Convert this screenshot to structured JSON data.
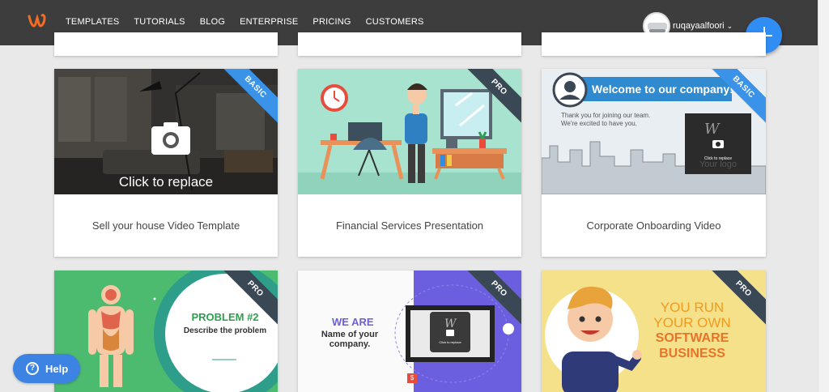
{
  "nav": {
    "logo_icon": "wideo-w-logo",
    "items": [
      "TEMPLATES",
      "TUTORIALS",
      "BLOG",
      "ENTERPRISE",
      "PRICING",
      "CUSTOMERS"
    ]
  },
  "user": {
    "name": "ruqayaalfoori",
    "caret": "⌄"
  },
  "fab": {
    "icon": "plus-icon"
  },
  "colors": {
    "topbar": "#3d3d3d",
    "accent": "#2f8df4",
    "basic_ribbon": "#3a93e8",
    "pro_ribbon": "#3a4755"
  },
  "cards": [
    {
      "title": "Sell your house Video Template",
      "badge": "BASIC",
      "overlay_text": "Click to replace",
      "icon": "camera-icon"
    },
    {
      "title": "Financial Services Presentation",
      "badge": "PRO"
    },
    {
      "title": "Corporate Onboarding Video",
      "badge": "BASIC",
      "headline": "Welcome to our company!",
      "body_line1": "Thank you for joining our team.",
      "body_line2": "We're excited to have you.",
      "placeholder_small": "Click to replace",
      "placeholder_logo": "Your logo"
    },
    {
      "badge": "PRO",
      "heading": "PROBLEM #2",
      "subheading": "Describe the problem"
    },
    {
      "badge": "PRO",
      "heading": "WE ARE",
      "subheading": "Name of your company.",
      "screen_text": "Click to replace",
      "icon_dollar": "$"
    },
    {
      "badge": "PRO",
      "line1": "YOU RUN",
      "line2": "YOUR OWN",
      "line3": "SOFTWARE",
      "line4": "BUSINESS"
    }
  ],
  "help": {
    "label": "Help",
    "icon": "question-icon",
    "glyph": "?"
  }
}
